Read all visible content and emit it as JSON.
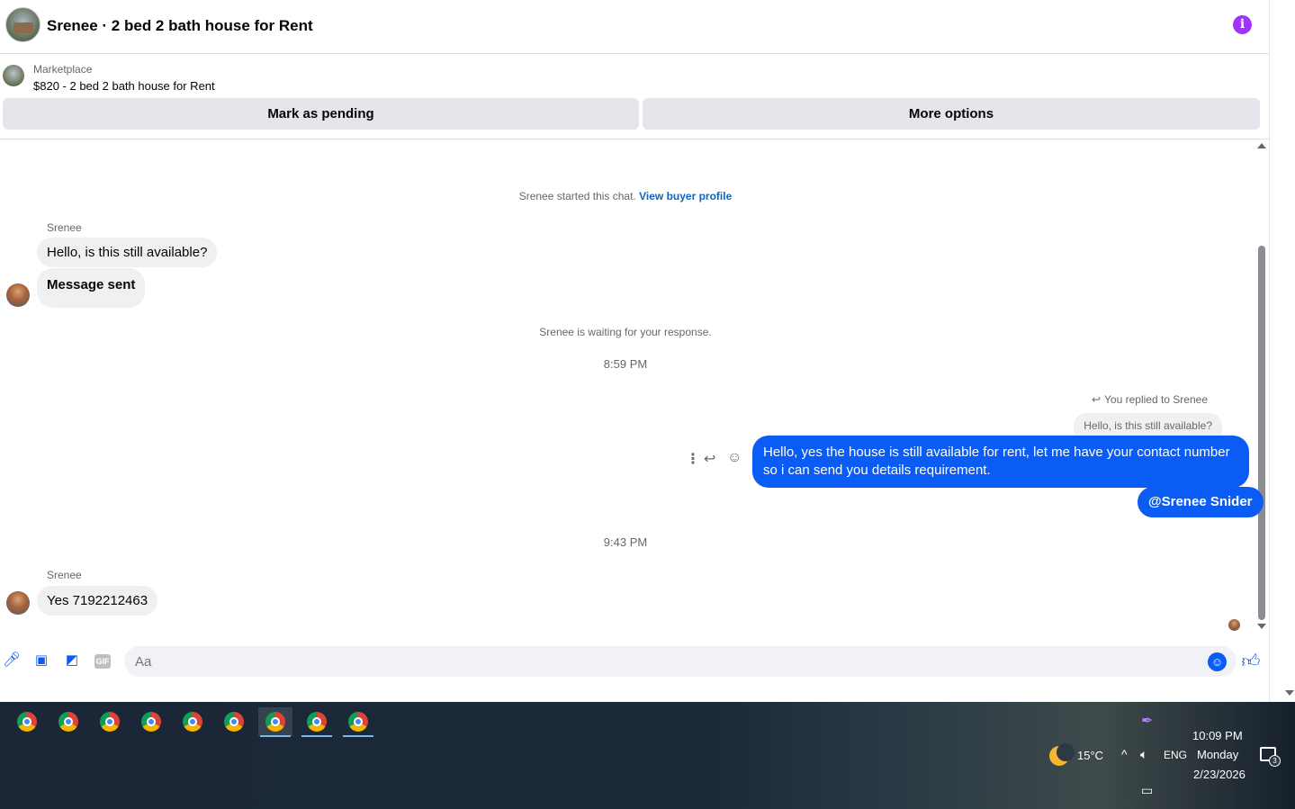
{
  "header": {
    "title": "Srenee · 2 bed 2 bath house for Rent",
    "info_icon": "info-icon",
    "accent_color": "#a033ff"
  },
  "listing": {
    "kicker": "Marketplace",
    "name": "$820 - 2 bed 2 bath house for Rent",
    "mark_pending_label": "Mark as pending",
    "more_options_label": "More options"
  },
  "conversation": {
    "started_text": "Srenee started this chat.",
    "view_profile_link": "View buyer profile",
    "sender_name_1": "Srenee",
    "msg_1": "Hello, is this still available?",
    "msg_2": "Message sent",
    "waiting_text": "Srenee is waiting for your response.",
    "time_1": "8:59 PM",
    "reply_note": "You replied to Srenee",
    "quoted_text": "Hello, is this still available?",
    "out_msg_1": "Hello, yes the house is still available for rent, let me have your contact number so i can send you details requirement.",
    "out_msg_2": "@Srenee Snider",
    "time_2": "9:43 PM",
    "sender_name_2": "Srenee",
    "msg_3": "Yes 7192212463",
    "outgoing_color": "#0a5cf5"
  },
  "composer": {
    "placeholder": "Aa",
    "icons": [
      "microphone-icon",
      "photo-icon",
      "sticker-icon",
      "gif-icon",
      "emoji-icon",
      "like-icon"
    ],
    "gif_label": "GIF"
  },
  "taskbar": {
    "apps": [
      "chrome",
      "chrome",
      "chrome",
      "chrome",
      "chrome",
      "chrome",
      "chrome",
      "chrome",
      "chrome"
    ],
    "weather": "15°C",
    "language": "ENG",
    "time": "10:09 PM",
    "day": "Monday",
    "date": "2/23/2026",
    "notification_count": "3"
  }
}
